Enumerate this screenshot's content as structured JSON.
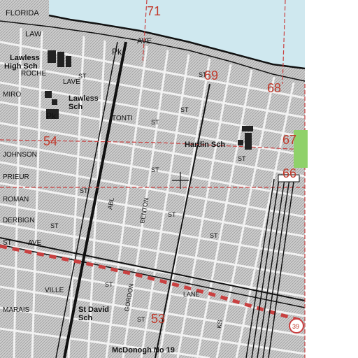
{
  "map": {
    "colors": {
      "water": "#cfe8ef",
      "urban": "#c9c9c9",
      "street": "#f4f4f4",
      "grid_red": "#c94040",
      "rail": "#111111",
      "building": "#222222",
      "park": "#8fd16a"
    },
    "streets": {
      "florida": "FLORIDA",
      "law": "LAW",
      "ave_top": "AVE",
      "pk_top": "Pk",
      "roche": "ROCHE",
      "lave": "LAVE",
      "miro": "MIRO",
      "tonti": "TONTI",
      "st_a": "ST",
      "st_b": "ST",
      "st_c": "ST",
      "st_d": "ST",
      "st_e": "ST",
      "st_f": "ST",
      "st_g": "ST",
      "st_h": "ST",
      "st_i": "ST",
      "st_j": "ST",
      "st_k": "ST",
      "st_l": "ST",
      "johnson": "JOHNSON",
      "prieur": "PRIEUR",
      "roman": "ROMAN",
      "derbign": "DERBIGN",
      "st_ave": "ST",
      "ave_left": "AVE",
      "ville": "VILLE",
      "marais": "MARAIS",
      "abl": "ABL",
      "benton": "BENTON",
      "gordon": "GORDON",
      "lane": "LANE",
      "st_ks": "KS"
    },
    "places": {
      "lawless_high_1": "Lawless",
      "lawless_high_2": "High Sch",
      "lawless_sch_1": "Lawless",
      "lawless_sch_2": "Sch",
      "pk_left": "Pk",
      "hardin": "Hardin Sch",
      "st_david_1": "St David",
      "st_david_2": "Sch",
      "mcdonogh": "McDonogh No 19"
    },
    "section_numbers": {
      "n71": "71",
      "n69": "69",
      "n68": "68",
      "n67": "67",
      "n66": "66",
      "n54": "54",
      "n53": "53",
      "n39": "39"
    }
  }
}
